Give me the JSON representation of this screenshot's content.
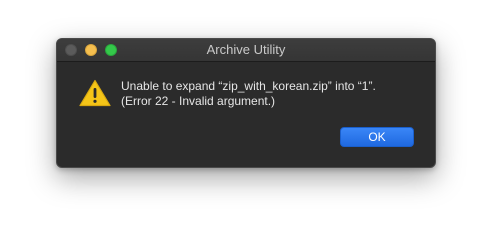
{
  "window": {
    "title": "Archive Utility"
  },
  "alert": {
    "icon": "warning-icon",
    "message_line1": "Unable to expand “zip_with_korean.zip” into “1”.",
    "message_line2": "(Error 22 - Invalid argument.)"
  },
  "buttons": {
    "ok_label": "OK"
  },
  "colors": {
    "accent": "#2a76ee",
    "warning": "#f5c518",
    "dialog_background": "#2b2b2b"
  }
}
